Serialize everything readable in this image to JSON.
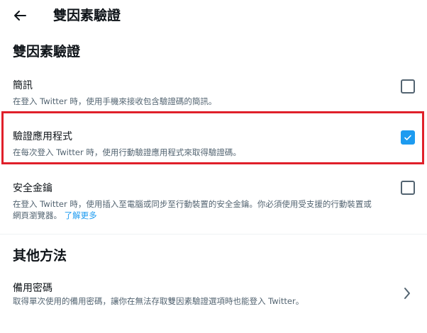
{
  "header": {
    "title": "雙因素驗證"
  },
  "section_main": {
    "heading": "雙因素驗證"
  },
  "options": [
    {
      "title": "簡訊",
      "desc": "在登入 Twitter 時，使用手機來接收包含驗證碼的簡訊。",
      "checked": false
    },
    {
      "title": "驗證應用程式",
      "desc": "在每次登入 Twitter 時，使用行動驗證應用程式來取得驗證碼。",
      "checked": true
    },
    {
      "title": "安全金鑰",
      "desc_line1": "在登入 Twitter 時，使用插入至電腦或同步至行動裝置的安全金鑰。你必須使用受支援的行動裝置或",
      "desc_line2": "網頁瀏覽器。",
      "link": "了解更多",
      "checked": false
    }
  ],
  "section_other": {
    "heading": "其他方法"
  },
  "backup": {
    "title": "備用密碼",
    "desc": "取得單次使用的備用密碼，讓你在無法存取雙因素驗證選項時也能登入 Twitter。"
  },
  "colors": {
    "accent": "#1d9bf0",
    "highlight": "#e0202a",
    "secondary_text": "#536471"
  }
}
